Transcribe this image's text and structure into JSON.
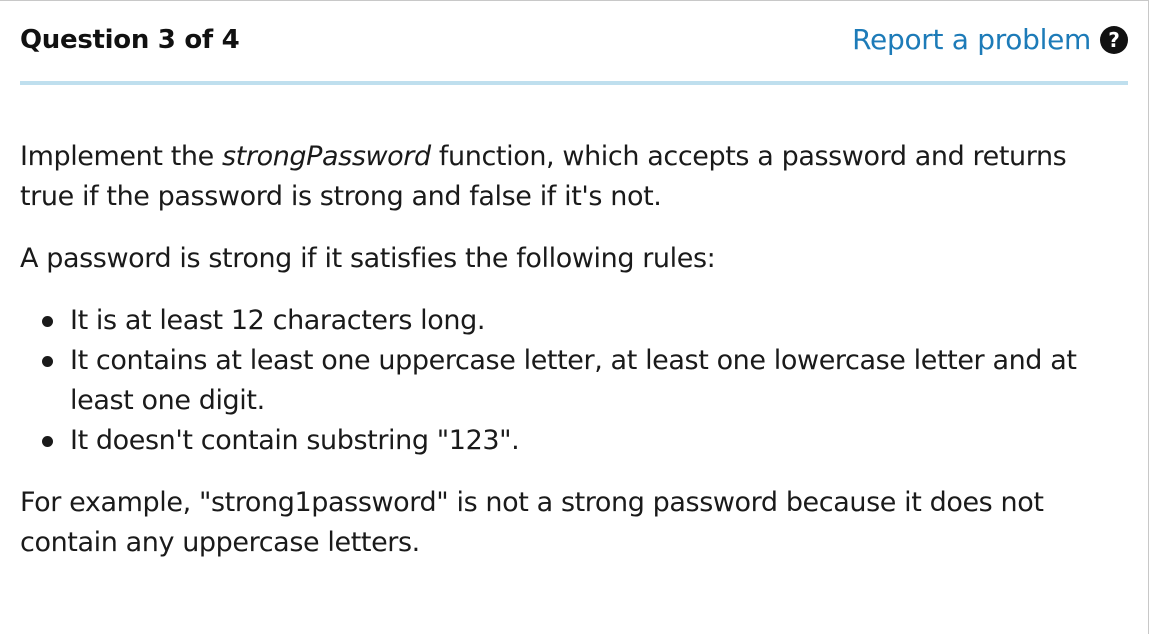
{
  "header": {
    "question_title": "Question 3 of 4",
    "report_label": "Report a problem",
    "help_icon_glyph": "?"
  },
  "prompt": {
    "intro_before": "Implement the ",
    "intro_emphasis": "strongPassword",
    "intro_after": " function, which accepts a password and returns true if the password is strong and false if it's not.",
    "rules_lead": "A password is strong if it satisfies the following rules:",
    "rules": [
      "It is at least 12 characters long.",
      "It contains at least one uppercase letter, at least one lowercase letter and at least one digit.",
      "It doesn't contain substring \"123\"."
    ],
    "example": "For example, \"strong1password\" is not a strong password because it does not contain any uppercase letters."
  },
  "colors": {
    "link": "#1d7bb8",
    "divider": "#bfdfee",
    "text": "#1a1a1a"
  },
  "icons": {
    "report": "question-circle-icon"
  }
}
